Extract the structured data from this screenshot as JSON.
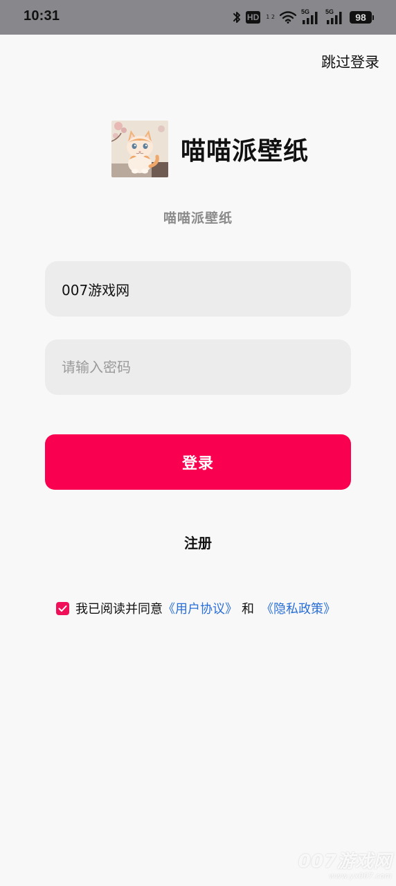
{
  "status_bar": {
    "time": "10:31",
    "hd_label": "HD",
    "hd_sub": "1 2",
    "network_labels": [
      "5G",
      "5G"
    ],
    "battery": "98",
    "background": "#88888c"
  },
  "header": {
    "skip_label": "跳过登录"
  },
  "brand": {
    "app_name": "喵喵派壁纸",
    "subtitle": "喵喵派壁纸",
    "logo_icon": "cat-logo-icon"
  },
  "form": {
    "account_value": "007游戏网",
    "password_placeholder": "请输入密码",
    "login_label": "登录",
    "register_label": "注册"
  },
  "agreement": {
    "checked": true,
    "prefix": "我已阅读并同意",
    "user_agreement": "《用户协议》",
    "and": "和",
    "privacy_policy": "《隐私政策》"
  },
  "watermark": {
    "title": "007游戏网",
    "url": "www.yx007.com"
  },
  "colors": {
    "accent": "#fa0050",
    "link": "#2a6ed8",
    "background": "#f8f8f8",
    "input_background": "#ececec"
  }
}
